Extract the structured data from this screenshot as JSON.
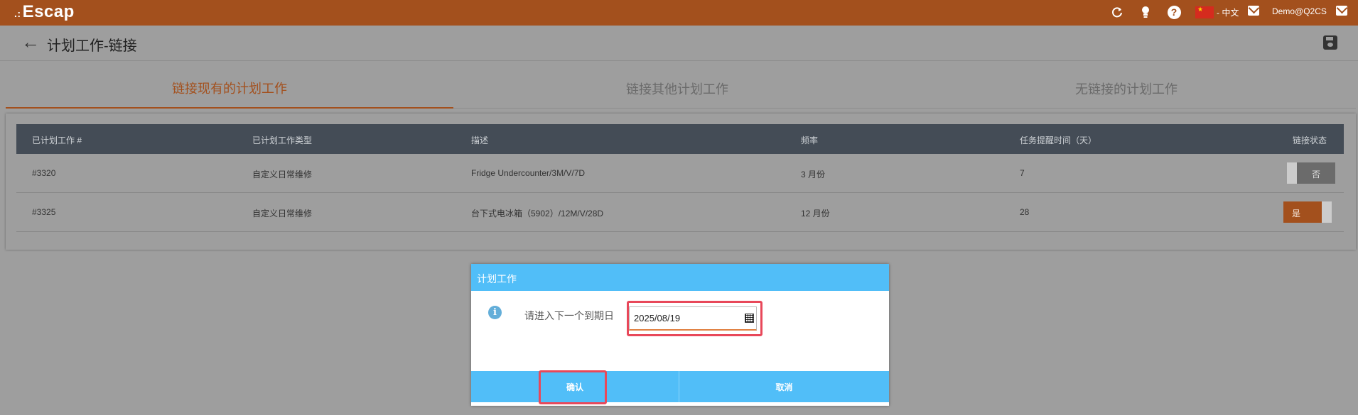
{
  "app": {
    "logo": "Escap",
    "logo_dots": ".:"
  },
  "topbar": {
    "refresh_icon": "refresh-icon",
    "bulb_icon": "lightbulb-icon",
    "help_icon": "?",
    "language": "- 中文",
    "user": "Demo@Q2CS"
  },
  "page": {
    "title": "计划工作-链接",
    "back_icon": "←"
  },
  "tabs": [
    {
      "label": "链接现有的计划工作",
      "active": true
    },
    {
      "label": "链接其他计划工作",
      "active": false
    },
    {
      "label": "无链接的计划工作",
      "active": false
    }
  ],
  "table": {
    "headers": [
      "已计划工作 #",
      "已计划工作类型",
      "描述",
      "频率",
      "任务提醒时间（天）",
      "链接状态"
    ],
    "rows": [
      {
        "id": "#3320",
        "type": "自定义日常维修",
        "desc": "Fridge Undercounter/3M/V/7D",
        "freq": "3 月份",
        "reminder": "7",
        "status": "否"
      },
      {
        "id": "#3325",
        "type": "自定义日常维修",
        "desc": "台下式电冰箱（5902）/12M/V/28D",
        "freq": "12 月份",
        "reminder": "28",
        "status": "是"
      }
    ]
  },
  "dialog": {
    "title": "计划工作",
    "prompt": "请进入下一个到期日",
    "date_value": "2025/08/19",
    "info_icon": "i",
    "confirm_label": "确认",
    "cancel_label": "取消"
  },
  "colors": {
    "brand": "#a3501d",
    "dialog_accent": "#51bef8",
    "highlight": "#e8485a"
  }
}
